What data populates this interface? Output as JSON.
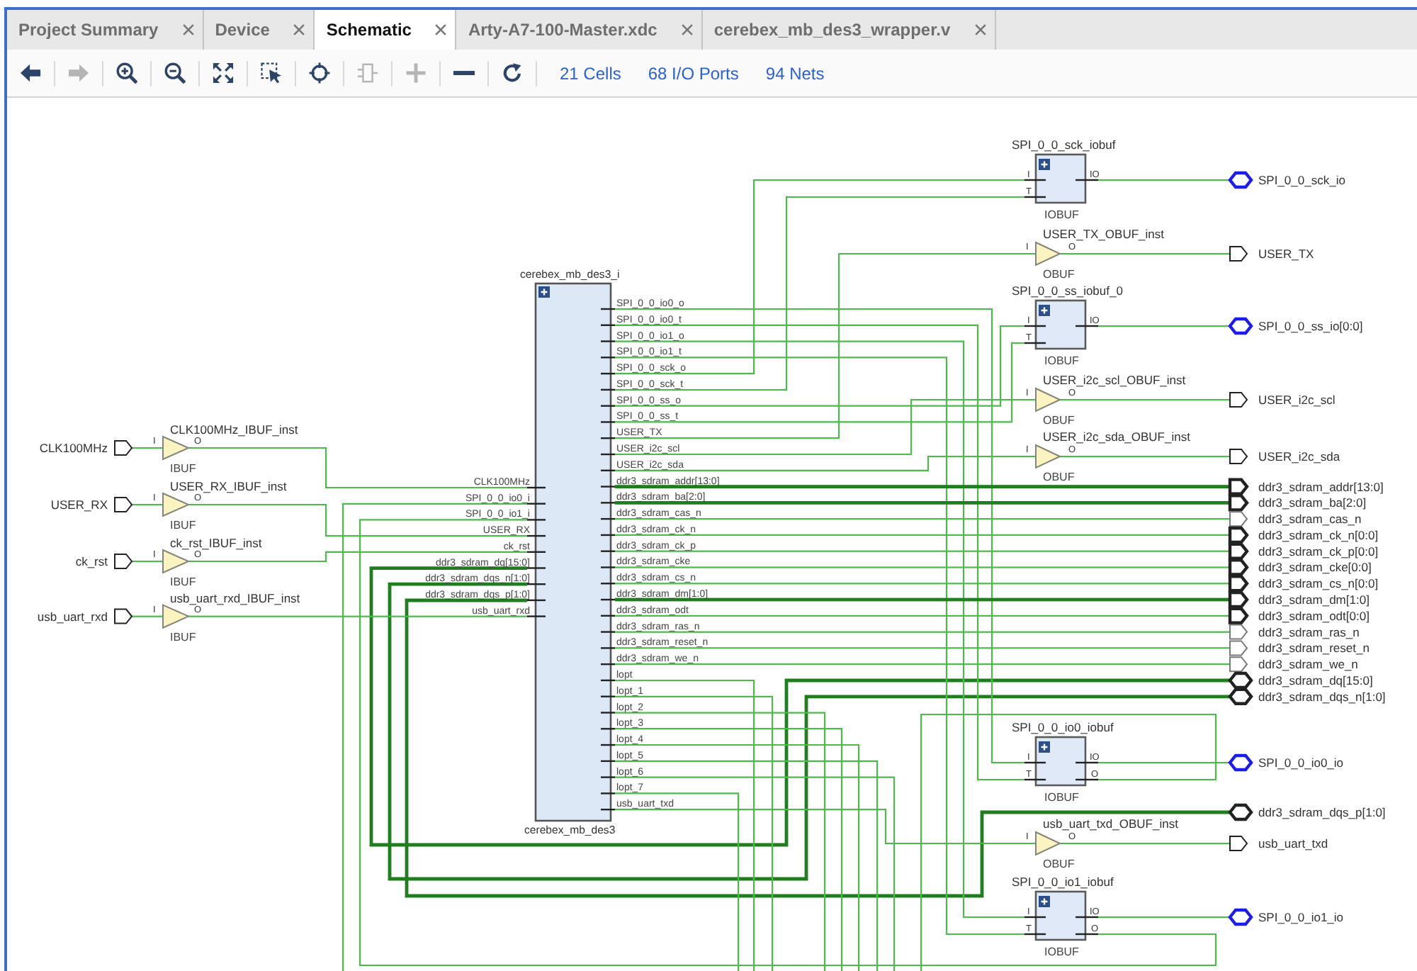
{
  "tabs": [
    {
      "label": "Project Summary",
      "selected": false
    },
    {
      "label": "Device",
      "selected": false
    },
    {
      "label": "Schematic",
      "selected": true
    },
    {
      "label": "Arty-A7-100-Master.xdc",
      "selected": false
    },
    {
      "label": "cerebex_mb_des3_wrapper.v",
      "selected": false
    }
  ],
  "toolbar": {
    "buttons": [
      {
        "kind": "back",
        "disabled": false
      },
      {
        "kind": "forward",
        "disabled": true
      },
      {
        "kind": "zoom_in",
        "disabled": false
      },
      {
        "kind": "zoom_out",
        "disabled": false
      },
      {
        "kind": "fit",
        "disabled": false
      },
      {
        "kind": "zoom_area",
        "disabled": false
      },
      {
        "kind": "center",
        "disabled": false
      },
      {
        "kind": "component",
        "disabled": true
      },
      {
        "kind": "expand",
        "disabled": true
      },
      {
        "kind": "collapse",
        "disabled": false
      },
      {
        "kind": "refresh",
        "disabled": false
      }
    ],
    "links": [
      "21 Cells",
      "68 I/O Ports",
      "94 Nets"
    ]
  },
  "schematic": {
    "input_ports": [
      {
        "name": "CLK100MHz",
        "buffer": {
          "instance": "CLK100MHz_IBUF_inst",
          "type": "IBUF",
          "pins": [
            "I",
            "O"
          ]
        }
      },
      {
        "name": "USER_RX",
        "buffer": {
          "instance": "USER_RX_IBUF_inst",
          "type": "IBUF",
          "pins": [
            "I",
            "O"
          ]
        }
      },
      {
        "name": "ck_rst",
        "buffer": {
          "instance": "ck_rst_IBUF_inst",
          "type": "IBUF",
          "pins": [
            "I",
            "O"
          ]
        }
      },
      {
        "name": "usb_uart_rxd",
        "buffer": {
          "instance": "usb_uart_rxd_IBUF_inst",
          "type": "IBUF",
          "pins": [
            "I",
            "O"
          ]
        }
      }
    ],
    "block": {
      "instance": "cerebex_mb_des3_i",
      "module": "cerebex_mb_des3",
      "left_pins": [
        "CLK100MHz",
        "SPI_0_0_io0_i",
        "SPI_0_0_io1_i",
        "USER_RX",
        "ck_rst",
        "ddr3_sdram_dq[15:0]",
        "ddr3_sdram_dqs_n[1:0]",
        "ddr3_sdram_dqs_p[1:0]",
        "usb_uart_rxd"
      ],
      "right_pins": [
        "SPI_0_0_io0_o",
        "SPI_0_0_io0_t",
        "SPI_0_0_io1_o",
        "SPI_0_0_io1_t",
        "SPI_0_0_sck_o",
        "SPI_0_0_sck_t",
        "SPI_0_0_ss_o",
        "SPI_0_0_ss_t",
        "USER_TX",
        "USER_i2c_scl",
        "USER_i2c_sda",
        "ddr3_sdram_addr[13:0]",
        "ddr3_sdram_ba[2:0]",
        "ddr3_sdram_cas_n",
        "ddr3_sdram_ck_n",
        "ddr3_sdram_ck_p",
        "ddr3_sdram_cke",
        "ddr3_sdram_cs_n",
        "ddr3_sdram_dm[1:0]",
        "ddr3_sdram_odt",
        "ddr3_sdram_ras_n",
        "ddr3_sdram_reset_n",
        "ddr3_sdram_we_n",
        "lopt",
        "lopt_1",
        "lopt_2",
        "lopt_3",
        "lopt_4",
        "lopt_5",
        "lopt_6",
        "lopt_7",
        "usb_uart_txd"
      ]
    },
    "cells": [
      {
        "kind": "iobuf",
        "instance": "SPI_0_0_sck_iobuf",
        "type": "IOBUF",
        "pins": [
          "I",
          "T",
          "IO"
        ]
      },
      {
        "kind": "obuf",
        "instance": "USER_TX_OBUF_inst",
        "type": "OBUF",
        "pins": [
          "I",
          "O"
        ]
      },
      {
        "kind": "iobuf",
        "instance": "SPI_0_0_ss_iobuf_0",
        "type": "IOBUF",
        "pins": [
          "I",
          "T",
          "IO"
        ]
      },
      {
        "kind": "obuf",
        "instance": "USER_i2c_scl_OBUF_inst",
        "type": "OBUF",
        "pins": [
          "I",
          "O"
        ]
      },
      {
        "kind": "obuf",
        "instance": "USER_i2c_sda_OBUF_inst",
        "type": "OBUF",
        "pins": [
          "I",
          "O"
        ]
      },
      {
        "kind": "iobuf",
        "instance": "SPI_0_0_io0_iobuf",
        "type": "IOBUF",
        "pins": [
          "I",
          "T",
          "IO",
          "O"
        ]
      },
      {
        "kind": "obuf",
        "instance": "usb_uart_txd_OBUF_inst",
        "type": "OBUF",
        "pins": [
          "I",
          "O"
        ]
      },
      {
        "kind": "iobuf",
        "instance": "SPI_0_0_io1_iobuf",
        "type": "IOBUF",
        "pins": [
          "I",
          "T",
          "IO",
          "O"
        ]
      }
    ],
    "output_ports": [
      {
        "name": "SPI_0_0_sck_io",
        "kind": "inout",
        "color": "#1c1cf0",
        "bold_outline": true,
        "thick_net": false
      },
      {
        "name": "USER_TX",
        "kind": "output",
        "color": "#222222",
        "bold_outline": false,
        "thick_net": false
      },
      {
        "name": "SPI_0_0_ss_io[0:0]",
        "kind": "inout",
        "color": "#1c1cf0",
        "bold_outline": true,
        "thick_net": false
      },
      {
        "name": "USER_i2c_scl",
        "kind": "output",
        "color": "#222222",
        "bold_outline": false,
        "thick_net": false
      },
      {
        "name": "USER_i2c_sda",
        "kind": "output",
        "color": "#222222",
        "bold_outline": false,
        "thick_net": false
      },
      {
        "name": "ddr3_sdram_addr[13:0]",
        "kind": "output",
        "color": "#222222",
        "bold_outline": true,
        "thick_net": true
      },
      {
        "name": "ddr3_sdram_ba[2:0]",
        "kind": "output",
        "color": "#222222",
        "bold_outline": true,
        "thick_net": true
      },
      {
        "name": "ddr3_sdram_cas_n",
        "kind": "output",
        "color": "#7a7a7a",
        "bold_outline": false,
        "thick_net": false
      },
      {
        "name": "ddr3_sdram_ck_n[0:0]",
        "kind": "output",
        "color": "#222222",
        "bold_outline": true,
        "thick_net": false
      },
      {
        "name": "ddr3_sdram_ck_p[0:0]",
        "kind": "output",
        "color": "#222222",
        "bold_outline": true,
        "thick_net": false
      },
      {
        "name": "ddr3_sdram_cke[0:0]",
        "kind": "output",
        "color": "#222222",
        "bold_outline": true,
        "thick_net": false
      },
      {
        "name": "ddr3_sdram_cs_n[0:0]",
        "kind": "output",
        "color": "#222222",
        "bold_outline": true,
        "thick_net": false
      },
      {
        "name": "ddr3_sdram_dm[1:0]",
        "kind": "output",
        "color": "#222222",
        "bold_outline": true,
        "thick_net": true
      },
      {
        "name": "ddr3_sdram_odt[0:0]",
        "kind": "output",
        "color": "#222222",
        "bold_outline": true,
        "thick_net": false
      },
      {
        "name": "ddr3_sdram_ras_n",
        "kind": "output",
        "color": "#7a7a7a",
        "bold_outline": false,
        "thick_net": false
      },
      {
        "name": "ddr3_sdram_reset_n",
        "kind": "output",
        "color": "#7a7a7a",
        "bold_outline": false,
        "thick_net": false
      },
      {
        "name": "ddr3_sdram_we_n",
        "kind": "output",
        "color": "#7a7a7a",
        "bold_outline": false,
        "thick_net": false
      },
      {
        "name": "ddr3_sdram_dq[15:0]",
        "kind": "inout",
        "color": "#222222",
        "bold_outline": true,
        "thick_net": true
      },
      {
        "name": "ddr3_sdram_dqs_n[1:0]",
        "kind": "inout",
        "color": "#222222",
        "bold_outline": true,
        "thick_net": true
      },
      {
        "name": "SPI_0_0_io0_io",
        "kind": "inout",
        "color": "#1c1cf0",
        "bold_outline": true,
        "thick_net": false
      },
      {
        "name": "ddr3_sdram_dqs_p[1:0]",
        "kind": "inout",
        "color": "#222222",
        "bold_outline": true,
        "thick_net": true
      },
      {
        "name": "usb_uart_txd",
        "kind": "output",
        "color": "#222222",
        "bold_outline": false,
        "thick_net": false
      },
      {
        "name": "SPI_0_0_io1_io",
        "kind": "inout",
        "color": "#1c1cf0",
        "bold_outline": true,
        "thick_net": false
      }
    ]
  }
}
